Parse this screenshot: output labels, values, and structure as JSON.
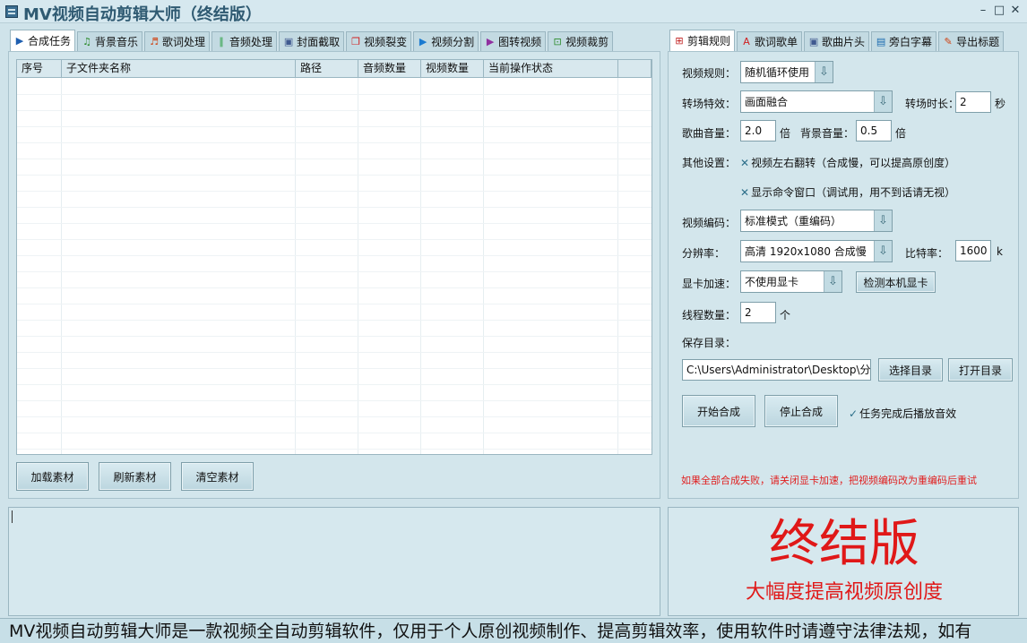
{
  "window": {
    "title": "MV视频自动剪辑大师（终结版）",
    "min": "–",
    "max": "□",
    "close": "✕"
  },
  "left_tabs": [
    {
      "label": "合成任务",
      "icon": "▶",
      "color": "#1f5fb0"
    },
    {
      "label": "背景音乐",
      "icon": "♫",
      "color": "#2a8a2a"
    },
    {
      "label": "歌词处理",
      "icon": "♬",
      "color": "#d04010"
    },
    {
      "label": "音频处理",
      "icon": "∥",
      "color": "#2aa040"
    },
    {
      "label": "封面截取",
      "icon": "▣",
      "color": "#405a90"
    },
    {
      "label": "视频裂变",
      "icon": "❐",
      "color": "#d02020"
    },
    {
      "label": "视频分割",
      "icon": "▶",
      "color": "#1a7ad0"
    },
    {
      "label": "图转视频",
      "icon": "▶",
      "color": "#9030a0"
    },
    {
      "label": "视频裁剪",
      "icon": "⊡",
      "color": "#2a8a2a"
    }
  ],
  "table": {
    "headers": [
      "序号",
      "子文件夹名称",
      "路径",
      "音频数量",
      "视频数量",
      "当前操作状态",
      ""
    ],
    "rows": []
  },
  "left_buttons": {
    "load": "加载素材",
    "refresh": "刷新素材",
    "clear": "清空素材"
  },
  "right_tabs": [
    {
      "label": "剪辑规则",
      "icon": "⊞",
      "color": "#c02020"
    },
    {
      "label": "歌词歌单",
      "icon": "A",
      "color": "#d02020"
    },
    {
      "label": "歌曲片头",
      "icon": "▣",
      "color": "#405a90"
    },
    {
      "label": "旁白字幕",
      "icon": "▤",
      "color": "#1a6ab0"
    },
    {
      "label": "导出标题",
      "icon": "✎",
      "color": "#d04010"
    }
  ],
  "settings": {
    "video_rule_label": "视频规则：",
    "video_rule_value": "随机循环使用",
    "transition_label": "转场特效：",
    "transition_value": "画面融合",
    "transition_dur_label": "转场时长：",
    "transition_dur_value": "2",
    "transition_dur_unit": "秒",
    "song_vol_label": "歌曲音量：",
    "song_vol_value": "2.0",
    "song_vol_unit": "倍",
    "bg_vol_label": "背景音量：",
    "bg_vol_value": "0.5",
    "bg_vol_unit": "倍",
    "other_label": "其他设置：",
    "flip_label": "视频左右翻转（合成慢，可以提高原创度）",
    "cmd_label": "显示命令窗口（调试用，用不到话请无视）",
    "encode_label": "视频编码：",
    "encode_value": "标准模式（重编码）",
    "resolution_label": "分辨率：",
    "resolution_value": "高清 1920x1080 合成慢",
    "bitrate_label": "比特率：",
    "bitrate_value": "1600",
    "bitrate_unit": "k",
    "gpu_label": "显卡加速：",
    "gpu_value": "不使用显卡",
    "gpu_detect": "检测本机显卡",
    "threads_label": "线程数量：",
    "threads_value": "2",
    "threads_unit": "个",
    "save_dir_label": "保存目录：",
    "save_dir_value": "C:\\Users\\Administrator\\Desktop\\分割",
    "choose_dir": "选择目录",
    "open_dir": "打开目录",
    "start": "开始合成",
    "stop": "停止合成",
    "play_sound": "任务完成后播放音效",
    "warning": "如果全部合成失败，请关闭显卡加速，把视频编码改为重编码后重试"
  },
  "brand": {
    "title": "终结版",
    "subtitle": "大幅度提高视频原创度"
  },
  "footer": {
    "marquee": "MV视频自动剪辑大师是一款视频全自动剪辑软件，仅用于个人原创视频制作、提高剪辑效率，使用软件时请遵守法律法规，如有"
  }
}
